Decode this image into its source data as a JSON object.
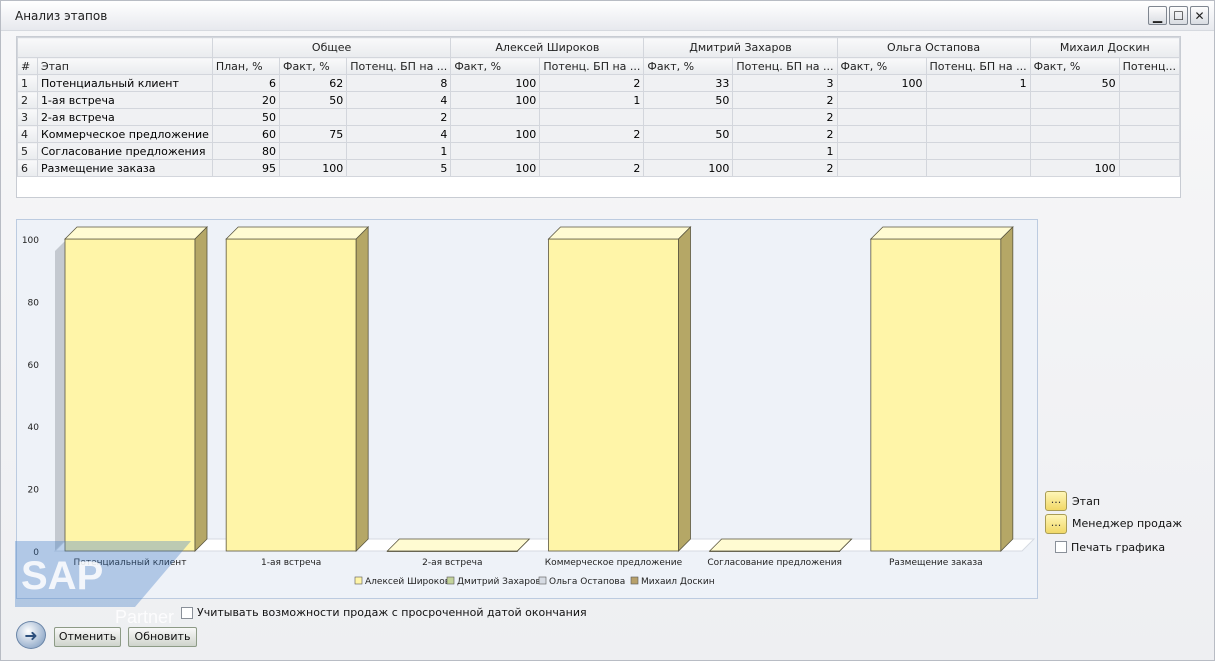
{
  "window": {
    "title": "Анализ этапов",
    "minimize": "▁",
    "maximize": "☐",
    "close": "✕"
  },
  "grid": {
    "groups": [
      "Общее",
      "Алексей Широков",
      "Дмитрий Захаров",
      "Ольга Остапова",
      "Михаил Доскин"
    ],
    "columns": [
      "#",
      "Этап",
      "План, %",
      "Факт, %",
      "Потенц. БП на ...",
      "Факт, %",
      "Потенц. БП на ...",
      "Факт, %",
      "Потенц. БП на ...",
      "Факт, %",
      "Потенц. БП на ...",
      "Факт, %",
      "Потенц..."
    ],
    "rows": [
      [
        "1",
        "Потенциальный клиент",
        "6",
        "62",
        "8",
        "100",
        "2",
        "33",
        "3",
        "100",
        "1",
        "50",
        ""
      ],
      [
        "2",
        "1-ая встреча",
        "20",
        "50",
        "4",
        "100",
        "1",
        "50",
        "2",
        "",
        "",
        "",
        ""
      ],
      [
        "3",
        "2-ая встреча",
        "50",
        "",
        "2",
        "",
        "",
        "",
        "2",
        "",
        "",
        "",
        ""
      ],
      [
        "4",
        "Коммерческое предложение",
        "60",
        "75",
        "4",
        "100",
        "2",
        "50",
        "2",
        "",
        "",
        "",
        ""
      ],
      [
        "5",
        "Согласование предложения",
        "80",
        "",
        "1",
        "",
        "",
        "",
        "1",
        "",
        "",
        "",
        ""
      ],
      [
        "6",
        "Размещение заказа",
        "95",
        "100",
        "5",
        "100",
        "2",
        "100",
        "2",
        "",
        "",
        "100",
        ""
      ]
    ],
    "scroll_grip": "⋮⋮"
  },
  "chart_data": {
    "type": "bar",
    "categories": [
      "Потенциальный клиент",
      "1-ая встреча",
      "2-ая встреча",
      "Коммерческое предложение",
      "Согласование предложения",
      "Размещение заказа"
    ],
    "series": [
      {
        "name": "Алексей Широков",
        "values": [
          100,
          100,
          0,
          100,
          0,
          100
        ],
        "color": "#fff5a8"
      },
      {
        "name": "Дмитрий Захаров",
        "values": [
          null,
          null,
          null,
          null,
          null,
          null
        ],
        "color": "#c3d39b"
      },
      {
        "name": "Ольга Остапова",
        "values": [
          null,
          null,
          null,
          null,
          null,
          null
        ],
        "color": "#d6dbe3"
      },
      {
        "name": "Михаил Доскин",
        "values": [
          null,
          null,
          null,
          null,
          null,
          null
        ],
        "color": "#b7a06b"
      }
    ],
    "yticks": [
      0,
      20,
      40,
      60,
      80,
      100
    ],
    "ylim": [
      0,
      100
    ],
    "legend": "bottom",
    "grid": false
  },
  "controls": {
    "stage_label": "Этап",
    "manager_label": "Менеджер продаж",
    "print_chart_label": "Печать графика",
    "overdue_label": "Учитывать возможности продаж с просроченной датой окончания",
    "dots": "...",
    "cancel": "Отменить",
    "refresh": "Обновить",
    "back_icon": "back-arrow-icon"
  },
  "watermark": {
    "brand": "SAP",
    "sub": "Partner"
  }
}
